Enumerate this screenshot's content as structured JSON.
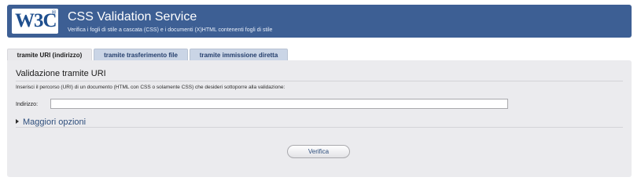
{
  "header": {
    "logo_text": "W3C",
    "logo_mark": "®",
    "title": "CSS Validation Service",
    "subtitle": "Verifica i fogli di stile a cascata (CSS) e i documenti (X)HTML contenenti fogli di stile"
  },
  "tabs": [
    {
      "label": "tramite URI (indirizzo)",
      "active": true
    },
    {
      "label": "tramite trasferimento file",
      "active": false
    },
    {
      "label": "tramite immissione diretta",
      "active": false
    }
  ],
  "form": {
    "section_title": "Validazione tramite URI",
    "instructions": "Inserisci il percorso (URI) di un documento (HTML con CSS o solamente CSS) che desideri sottoporre alla validazione:",
    "address_label": "Indirizzo:",
    "address_value": "",
    "more_options": "Maggiori opzioni",
    "submit_label": "Verifica"
  },
  "colors": {
    "banner": "#3d5f94",
    "panel": "#ebebee",
    "tab_inactive": "#cad5e6",
    "link": "#2e4e7c"
  }
}
